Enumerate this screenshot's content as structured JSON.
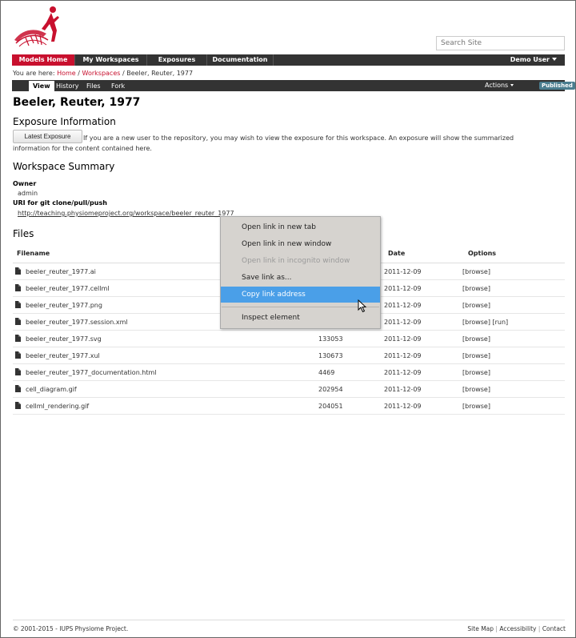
{
  "search": {
    "placeholder": "Search Site"
  },
  "nav": {
    "items": [
      "Models Home",
      "My Workspaces",
      "Exposures",
      "Documentation"
    ],
    "user": "Demo User"
  },
  "breadcrumb": {
    "prefix": "You are here:",
    "home": "Home",
    "workspaces": "Workspaces",
    "current": "Beeler, Reuter, 1977",
    "sep": "/"
  },
  "tabs": {
    "items": [
      "View",
      "History",
      "Files",
      "Fork"
    ],
    "actions": "Actions",
    "status": "Published"
  },
  "page": {
    "title": "Beeler, Reuter, 1977",
    "exposure_heading": "Exposure Information",
    "exposure_button": "Latest Exposure",
    "exposure_text_1": "If you are a new user to the repository, you may wish to view the exposure for this workspace. An exposure will show the summarized",
    "exposure_text_2": "information for the content contained here.",
    "summary_heading": "Workspace Summary",
    "owner_label": "Owner",
    "owner_value": "admin",
    "uri_label": "URI for git clone/pull/push",
    "uri_value": "http://teaching.physiomeproject.org/workspace/beeler_reuter_1977",
    "files_heading": "Files"
  },
  "table": {
    "headers": {
      "filename": "Filename",
      "date": "Date",
      "options": "Options"
    },
    "rows": [
      {
        "name": "beeler_reuter_1977.ai",
        "size": "",
        "date": "2011-12-09",
        "options": "[browse]"
      },
      {
        "name": "beeler_reuter_1977.cellml",
        "size": "",
        "date": "2011-12-09",
        "options": "[browse]"
      },
      {
        "name": "beeler_reuter_1977.png",
        "size": "",
        "date": "2011-12-09",
        "options": "[browse]"
      },
      {
        "name": "beeler_reuter_1977.session.xml",
        "size": "",
        "date": "2011-12-09",
        "options": "[browse] [run]"
      },
      {
        "name": "beeler_reuter_1977.svg",
        "size": "133053",
        "date": "2011-12-09",
        "options": "[browse]"
      },
      {
        "name": "beeler_reuter_1977.xul",
        "size": "130673",
        "date": "2011-12-09",
        "options": "[browse]"
      },
      {
        "name": "beeler_reuter_1977_documentation.html",
        "size": "4469",
        "date": "2011-12-09",
        "options": "[browse]"
      },
      {
        "name": "cell_diagram.gif",
        "size": "202954",
        "date": "2011-12-09",
        "options": "[browse]"
      },
      {
        "name": "cellml_rendering.gif",
        "size": "204051",
        "date": "2011-12-09",
        "options": "[browse]"
      }
    ]
  },
  "context_menu": {
    "items": [
      "Open link in new tab",
      "Open link in new window",
      "Open link in incognito window",
      "Save link as...",
      "Copy link address",
      "Inspect element"
    ]
  },
  "footer": {
    "copyright": "© 2001-2015 - IUPS Physiome Project.",
    "links": [
      "Site Map",
      "Accessibility",
      "Contact"
    ],
    "sep": "|"
  },
  "colors": {
    "brand_red": "#c8102e",
    "nav_dark": "#333333",
    "menu_highlight": "#4a9fe8",
    "badge": "#4a7d8f"
  }
}
